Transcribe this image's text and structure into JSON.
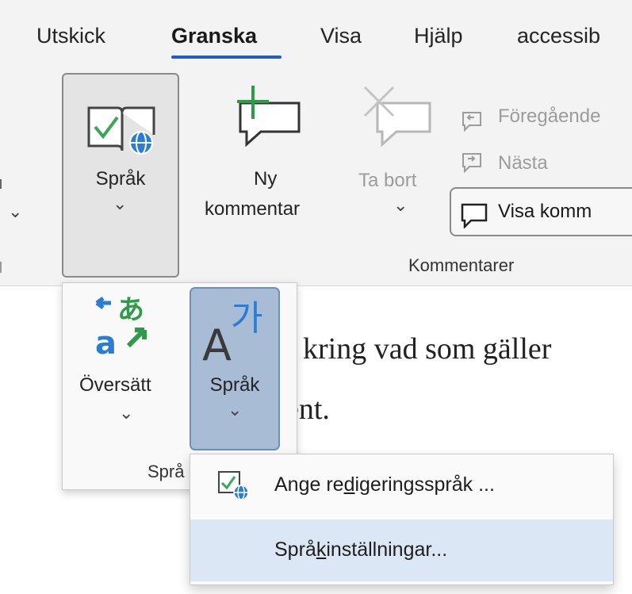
{
  "tabs": [
    {
      "label": "Utskick",
      "active": false
    },
    {
      "label": "Granska",
      "active": true
    },
    {
      "label": "Visa",
      "active": false
    },
    {
      "label": "Hjälp",
      "active": false
    },
    {
      "label": "accessib",
      "active": false
    }
  ],
  "ribbon": {
    "sprak_button": {
      "label": "Språk",
      "icon": "language-check-globe-icon"
    },
    "ny_kommentar": {
      "line1": "Ny",
      "line2": "kommentar",
      "icon": "new-comment-icon"
    },
    "ta_bort": {
      "label": "Ta bort",
      "icon": "delete-comment-icon",
      "disabled": true
    },
    "foregaende": {
      "label": "Föregående",
      "icon": "previous-comment-icon"
    },
    "nasta": {
      "label": "Nästa",
      "icon": "next-comment-icon"
    },
    "visa_kommentarer": {
      "label": "Visa komm",
      "icon": "show-comments-icon"
    },
    "kommentarer_group": "Kommentarer"
  },
  "document": {
    "line1": "kring vad som gäller",
    "line2": "ent."
  },
  "language_panel": {
    "oversatt": {
      "label": "Översätt",
      "icon": "translate-icon"
    },
    "sprak": {
      "label": "Språk",
      "icon": "language-icon"
    },
    "group_label": "Språ"
  },
  "submenu": {
    "items": [
      {
        "pre": "Ange re",
        "accel": "d",
        "post": "igeringsspråk ...",
        "icon": "proofing-language-icon",
        "highlighted": false
      },
      {
        "pre": "Språ",
        "accel": "k",
        "post": "inställningar...",
        "icon": "",
        "highlighted": true
      }
    ]
  },
  "colors": {
    "accent": "#1f5fbf",
    "selected_button": "#a9bcd6",
    "hover_item": "#dce7f5"
  }
}
